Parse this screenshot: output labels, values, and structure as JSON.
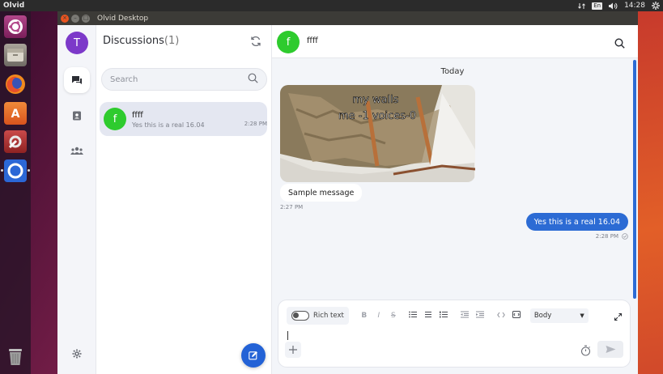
{
  "topbar": {
    "app_name": "Olvid",
    "lang": "En",
    "time": "14:28",
    "icons": [
      "network-icon",
      "volume-icon",
      "system-gear-icon"
    ]
  },
  "window": {
    "title": "Olvid Desktop"
  },
  "launcher": {
    "items": [
      "ubuntu-dash-icon",
      "files-icon",
      "firefox-icon",
      "software-center-icon",
      "settings-icon",
      "olvid-icon",
      "trash-icon"
    ]
  },
  "rail": {
    "avatar_letter": "T",
    "items": [
      "discussions-icon",
      "contacts-icon",
      "groups-icon"
    ],
    "settings": "settings-icon"
  },
  "discussions": {
    "title": "Discussions",
    "count": "(1)",
    "search_placeholder": "Search",
    "items": [
      {
        "avatar_letter": "f",
        "name": "ffff",
        "last_message": "Yes this is a real 16.04",
        "time": "2:28 PM"
      }
    ]
  },
  "chat": {
    "avatar_letter": "f",
    "name": "ffff",
    "day_label": "Today",
    "image_caption_top": "my walls",
    "image_caption_bottom": "me -1    voices-0",
    "incoming": {
      "text": "Sample message",
      "time": "2:27 PM"
    },
    "outgoing": {
      "text": "Yes this is a real 16.04",
      "time": "2:28 PM"
    }
  },
  "composer": {
    "rich_text_label": "Rich text",
    "style_value": "Body",
    "format_buttons": [
      "B",
      "I",
      "S"
    ]
  },
  "colors": {
    "accent": "#2c6bd4",
    "avatar_me": "#7c39c9",
    "avatar_contact": "#2ecb2e",
    "titlebar": "#3c3b37"
  }
}
